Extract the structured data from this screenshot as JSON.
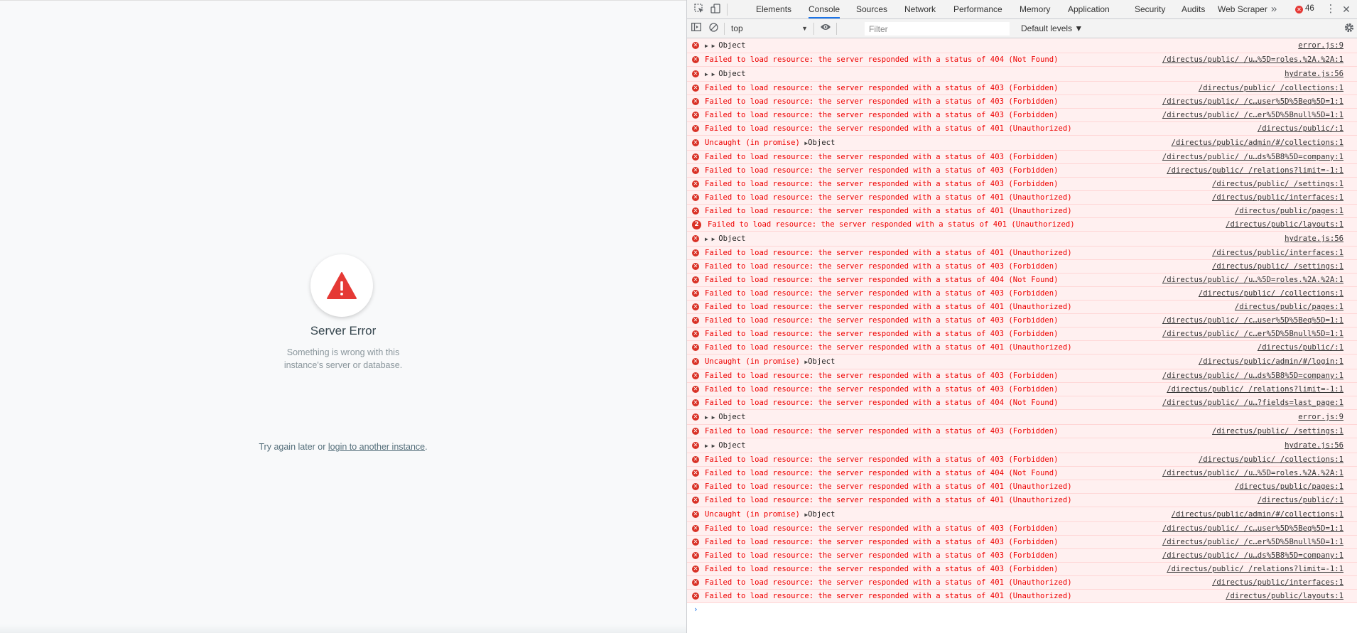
{
  "page": {
    "error_title": "Server Error",
    "error_desc_line1": "Something is wrong with this",
    "error_desc_line2": "instance's server or database.",
    "retry_prefix": "Try again later or ",
    "retry_link": "login to another instance",
    "retry_suffix": "."
  },
  "devtools": {
    "tabs": [
      "Elements",
      "Console",
      "Sources",
      "Network",
      "Performance",
      "Memory",
      "Application",
      "Security",
      "Audits",
      "Web Scraper"
    ],
    "active_tab": "Console",
    "error_count": "46",
    "more_tabs_glyph": "»",
    "menu_glyph": "⋮",
    "close_glyph": "✕",
    "context": "top",
    "filter_placeholder": "Filter",
    "levels": "Default levels ▼",
    "prompt": "›"
  },
  "icons": {
    "inspect": "inspect-icon",
    "device": "device-toggle-icon",
    "sidebar": "sidebar-toggle-icon",
    "clear": "clear-console-icon",
    "eye": "live-expression-icon",
    "settings": "settings-gear-icon",
    "error": "error-circle-icon",
    "warning": "warning-triangle-icon"
  },
  "colors": {
    "error_red": "#ee0000",
    "error_bg": "#fff0f0",
    "warning_red": "#e53935",
    "active_tab": "#1a73e8"
  },
  "console_rows": [
    {
      "type": "obj",
      "msg": "Object",
      "src": "error.js:9"
    },
    {
      "type": "err",
      "msg": "Failed to load resource: the server responded with a status of 404 (Not Found)",
      "src": "/directus/public/ /u…%5D=roles.%2A.%2A:1"
    },
    {
      "type": "obj",
      "msg": "Object",
      "src": "hydrate.js:56"
    },
    {
      "type": "err",
      "msg": "Failed to load resource: the server responded with a status of 403 (Forbidden)",
      "src": "/directus/public/ /collections:1"
    },
    {
      "type": "err",
      "msg": "Failed to load resource: the server responded with a status of 403 (Forbidden)",
      "src": "/directus/public/ /c…user%5D%5Beq%5D=1:1"
    },
    {
      "type": "err",
      "msg": "Failed to load resource: the server responded with a status of 403 (Forbidden)",
      "src": "/directus/public/ /c…er%5D%5Bnull%5D=1:1"
    },
    {
      "type": "err",
      "msg": "Failed to load resource: the server responded with a status of 401 (Unauthorized)",
      "src": "/directus/public/:1"
    },
    {
      "type": "uncaught",
      "msg": "Uncaught (in promise) ",
      "src": "/directus/public/admin/#/collections:1"
    },
    {
      "type": "err",
      "msg": "Failed to load resource: the server responded with a status of 403 (Forbidden)",
      "src": "/directus/public/ /u…ds%5B8%5D=company:1"
    },
    {
      "type": "err",
      "msg": "Failed to load resource: the server responded with a status of 403 (Forbidden)",
      "src": "/directus/public/ /relations?limit=-1:1"
    },
    {
      "type": "err",
      "msg": "Failed to load resource: the server responded with a status of 403 (Forbidden)",
      "src": "/directus/public/ /settings:1"
    },
    {
      "type": "err",
      "msg": "Failed to load resource: the server responded with a status of 401 (Unauthorized)",
      "src": "/directus/public/interfaces:1"
    },
    {
      "type": "err",
      "msg": "Failed to load resource: the server responded with a status of 401 (Unauthorized)",
      "src": "/directus/public/pages:1"
    },
    {
      "type": "cnt",
      "count": "2",
      "msg": "Failed to load resource: the server responded with a status of 401 (Unauthorized)",
      "src": "/directus/public/layouts:1"
    },
    {
      "type": "obj",
      "msg": "Object",
      "src": "hydrate.js:56"
    },
    {
      "type": "err",
      "msg": "Failed to load resource: the server responded with a status of 401 (Unauthorized)",
      "src": "/directus/public/interfaces:1"
    },
    {
      "type": "err",
      "msg": "Failed to load resource: the server responded with a status of 403 (Forbidden)",
      "src": "/directus/public/ /settings:1"
    },
    {
      "type": "err",
      "msg": "Failed to load resource: the server responded with a status of 404 (Not Found)",
      "src": "/directus/public/ /u…%5D=roles.%2A.%2A:1"
    },
    {
      "type": "err",
      "msg": "Failed to load resource: the server responded with a status of 403 (Forbidden)",
      "src": "/directus/public/ /collections:1"
    },
    {
      "type": "err",
      "msg": "Failed to load resource: the server responded with a status of 401 (Unauthorized)",
      "src": "/directus/public/pages:1"
    },
    {
      "type": "err",
      "msg": "Failed to load resource: the server responded with a status of 403 (Forbidden)",
      "src": "/directus/public/ /c…user%5D%5Beq%5D=1:1"
    },
    {
      "type": "err",
      "msg": "Failed to load resource: the server responded with a status of 403 (Forbidden)",
      "src": "/directus/public/ /c…er%5D%5Bnull%5D=1:1"
    },
    {
      "type": "err",
      "msg": "Failed to load resource: the server responded with a status of 401 (Unauthorized)",
      "src": "/directus/public/:1"
    },
    {
      "type": "uncaught",
      "msg": "Uncaught (in promise) ",
      "src": "/directus/public/admin/#/login:1"
    },
    {
      "type": "err",
      "msg": "Failed to load resource: the server responded with a status of 403 (Forbidden)",
      "src": "/directus/public/ /u…ds%5B8%5D=company:1"
    },
    {
      "type": "err",
      "msg": "Failed to load resource: the server responded with a status of 403 (Forbidden)",
      "src": "/directus/public/ /relations?limit=-1:1"
    },
    {
      "type": "err",
      "msg": "Failed to load resource: the server responded with a status of 404 (Not Found)",
      "src": "/directus/public/ /u…?fields=last_page:1"
    },
    {
      "type": "obj",
      "msg": "Object",
      "src": "error.js:9"
    },
    {
      "type": "err",
      "msg": "Failed to load resource: the server responded with a status of 403 (Forbidden)",
      "src": "/directus/public/ /settings:1"
    },
    {
      "type": "obj",
      "msg": "Object",
      "src": "hydrate.js:56"
    },
    {
      "type": "err",
      "msg": "Failed to load resource: the server responded with a status of 403 (Forbidden)",
      "src": "/directus/public/ /collections:1"
    },
    {
      "type": "err",
      "msg": "Failed to load resource: the server responded with a status of 404 (Not Found)",
      "src": "/directus/public/ /u…%5D=roles.%2A.%2A:1"
    },
    {
      "type": "err",
      "msg": "Failed to load resource: the server responded with a status of 401 (Unauthorized)",
      "src": "/directus/public/pages:1"
    },
    {
      "type": "err",
      "msg": "Failed to load resource: the server responded with a status of 401 (Unauthorized)",
      "src": "/directus/public/:1"
    },
    {
      "type": "uncaught",
      "msg": "Uncaught (in promise) ",
      "src": "/directus/public/admin/#/collections:1"
    },
    {
      "type": "err",
      "msg": "Failed to load resource: the server responded with a status of 403 (Forbidden)",
      "src": "/directus/public/ /c…user%5D%5Beq%5D=1:1"
    },
    {
      "type": "err",
      "msg": "Failed to load resource: the server responded with a status of 403 (Forbidden)",
      "src": "/directus/public/ /c…er%5D%5Bnull%5D=1:1"
    },
    {
      "type": "err",
      "msg": "Failed to load resource: the server responded with a status of 403 (Forbidden)",
      "src": "/directus/public/ /u…ds%5B8%5D=company:1"
    },
    {
      "type": "err",
      "msg": "Failed to load resource: the server responded with a status of 403 (Forbidden)",
      "src": "/directus/public/ /relations?limit=-1:1"
    },
    {
      "type": "err",
      "msg": "Failed to load resource: the server responded with a status of 401 (Unauthorized)",
      "src": "/directus/public/interfaces:1"
    },
    {
      "type": "err",
      "msg": "Failed to load resource: the server responded with a status of 401 (Unauthorized)",
      "src": "/directus/public/layouts:1"
    }
  ]
}
